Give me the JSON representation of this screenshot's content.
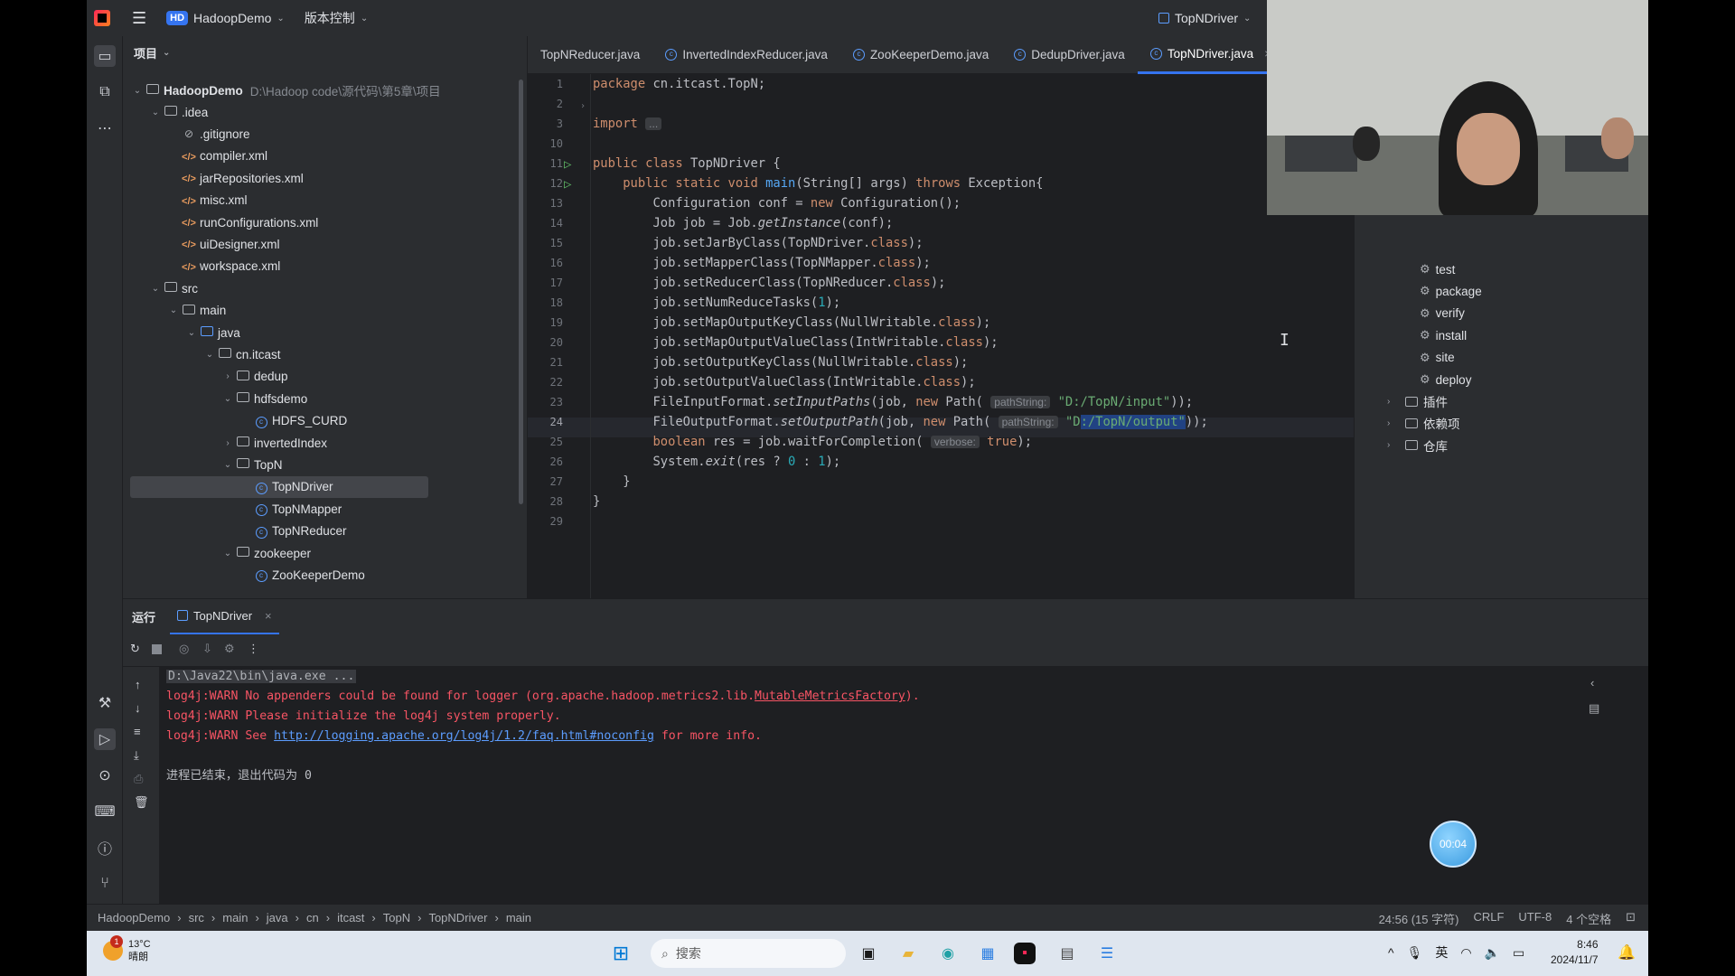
{
  "titlebar": {
    "project_badge": "HD",
    "project_name": "HadoopDemo",
    "vcs_label": "版本控制",
    "run_config": "TopNDriver"
  },
  "project_panel": {
    "title": "项目",
    "root": {
      "name": "HadoopDemo",
      "path": "D:\\Hadoop code\\源代码\\第5章\\项目"
    },
    "tree": [
      {
        "label": ".idea",
        "type": "folder",
        "level": 1,
        "open": true
      },
      {
        "label": ".gitignore",
        "type": "ignore",
        "level": 2
      },
      {
        "label": "compiler.xml",
        "type": "xml",
        "level": 2
      },
      {
        "label": "jarRepositories.xml",
        "type": "xml",
        "level": 2
      },
      {
        "label": "misc.xml",
        "type": "xml",
        "level": 2
      },
      {
        "label": "runConfigurations.xml",
        "type": "xml",
        "level": 2
      },
      {
        "label": "uiDesigner.xml",
        "type": "xml",
        "level": 2
      },
      {
        "label": "workspace.xml",
        "type": "xml",
        "level": 2
      },
      {
        "label": "src",
        "type": "folder",
        "level": 1,
        "open": true
      },
      {
        "label": "main",
        "type": "folder",
        "level": 2,
        "open": true
      },
      {
        "label": "java",
        "type": "folder-blue",
        "level": 3,
        "open": true
      },
      {
        "label": "cn.itcast",
        "type": "folder",
        "level": 4,
        "open": true
      },
      {
        "label": "dedup",
        "type": "folder",
        "level": 5,
        "open": false
      },
      {
        "label": "hdfsdemo",
        "type": "folder",
        "level": 5,
        "open": true
      },
      {
        "label": "HDFS_CURD",
        "type": "class",
        "level": 6
      },
      {
        "label": "invertedIndex",
        "type": "folder",
        "level": 5,
        "open": false
      },
      {
        "label": "TopN",
        "type": "folder",
        "level": 5,
        "open": true
      },
      {
        "label": "TopNDriver",
        "type": "class",
        "level": 6,
        "selected": true
      },
      {
        "label": "TopNMapper",
        "type": "class",
        "level": 6
      },
      {
        "label": "TopNReducer",
        "type": "class",
        "level": 6
      },
      {
        "label": "zookeeper",
        "type": "folder",
        "level": 5,
        "open": true
      },
      {
        "label": "ZooKeeperDemo",
        "type": "class",
        "level": 6
      }
    ]
  },
  "editor": {
    "tabs": [
      {
        "label": "TopNReducer.java",
        "active": false
      },
      {
        "label": "InvertedIndexReducer.java",
        "active": false
      },
      {
        "label": "ZooKeeperDemo.java",
        "active": false
      },
      {
        "label": "DedupDriver.java",
        "active": false
      },
      {
        "label": "TopNDriver.java",
        "active": true
      }
    ],
    "line_numbers": [
      "1",
      "2",
      "3",
      "10",
      "11",
      "12",
      "13",
      "14",
      "15",
      "16",
      "17",
      "18",
      "19",
      "20",
      "21",
      "22",
      "23",
      "24",
      "25",
      "26",
      "27",
      "28",
      "29"
    ],
    "code": {
      "l1_kw": "package",
      "l1_rest": " cn.itcast.TopN;",
      "l3_kw": "import",
      "l3_fold": "...",
      "l11_kw": "public class",
      "l11_rest": " TopNDriver {",
      "l12_kw1": "public static void",
      "l12_fn": "main",
      "l12_mid": "(String[] args) ",
      "l12_kw2": "throws",
      "l12_rest": " Exception{",
      "l13_a": "Configuration conf = ",
      "l13_kw": "new",
      "l13_b": " Configuration();",
      "l14_a": "Job job = Job.",
      "l14_it": "getInstance",
      "l14_b": "(conf);",
      "l15_a": "job.setJarByClass(TopNDriver.",
      "l15_kw": "class",
      "l15_b": ");",
      "l16_a": "job.setMapperClass(TopNMapper.",
      "l16_kw": "class",
      "l16_b": ");",
      "l17_a": "job.setReducerClass(TopNReducer.",
      "l17_kw": "class",
      "l17_b": ");",
      "l18_a": "job.setNumReduceTasks(",
      "l18_num": "1",
      "l18_b": ");",
      "l19_a": "job.setMapOutputKeyClass(NullWritable.",
      "l19_kw": "class",
      "l19_b": ");",
      "l20_a": "job.setMapOutputValueClass(IntWritable.",
      "l20_kw": "class",
      "l20_b": ");",
      "l21_a": "job.setOutputKeyClass(NullWritable.",
      "l21_kw": "class",
      "l21_b": ");",
      "l22_a": "job.setOutputValueClass(IntWritable.",
      "l22_kw": "class",
      "l22_b": ");",
      "l23_a": "FileInputFormat.",
      "l23_it": "setInputPaths",
      "l23_b": "(job, ",
      "l23_kw": "new",
      "l23_c": " Path(",
      "l23_hint": "pathString:",
      "l23_str": "\"D:/TopN/input\"",
      "l23_d": "));",
      "l24_a": "FileOutputFormat.",
      "l24_it": "setOutputPath",
      "l24_b": "(job, ",
      "l24_kw": "new",
      "l24_c": " Path(",
      "l24_hint": "pathString:",
      "l24_str1": "\"D",
      "l24_sel": ":/TopN/output\"",
      "l24_d": "));",
      "l25_kw": "boolean",
      "l25_a": " res = job.waitForCompletion(",
      "l25_hint": "verbose:",
      "l25_kw2": "true",
      "l25_b": ");",
      "l26_a": "System.",
      "l26_it": "exit",
      "l26_b": "(res ? ",
      "l26_n0": "0",
      "l26_c": " : ",
      "l26_n1": "1",
      "l26_d": ");",
      "l27": "}",
      "l28": "}"
    }
  },
  "maven_panel": {
    "lifecycle": [
      "test",
      "package",
      "verify",
      "install",
      "site",
      "deploy"
    ],
    "groups": [
      "插件",
      "依赖项",
      "仓库"
    ]
  },
  "run_panel": {
    "title": "运行",
    "tab": "TopNDriver",
    "cmd": "D:\\Java22\\bin\\java.exe ...",
    "warn1_a": "log4j:WARN No appenders could be found for logger (org.apache.hadoop.metrics2.lib.",
    "warn1_link": "MutableMetricsFactory",
    "warn1_b": ").",
    "warn2": "log4j:WARN Please initialize the log4j system properly.",
    "warn3_a": "log4j:WARN See ",
    "warn3_link": "http://logging.apache.org/log4j/1.2/faq.html#noconfig",
    "warn3_b": " for more info.",
    "exit_msg": "进程已结束，退出代码为 0"
  },
  "timer": "00:04",
  "statusbar": {
    "breadcrumb": [
      "HadoopDemo",
      "src",
      "main",
      "java",
      "cn",
      "itcast",
      "TopN",
      "TopNDriver",
      "main"
    ],
    "position": "24:56 (15 字符)",
    "line_sep": "CRLF",
    "encoding": "UTF-8",
    "indent": "4 个空格"
  },
  "taskbar": {
    "temperature": "13°C",
    "weather": "晴朗",
    "weather_badge": "1",
    "search_placeholder": "搜索",
    "ime": "英",
    "time": "8:46",
    "date": "2024/11/7"
  },
  "colors": {
    "accent": "#3574f0",
    "keyword": "#cf8e6d",
    "string": "#6aab73",
    "warn": "#f75464"
  }
}
